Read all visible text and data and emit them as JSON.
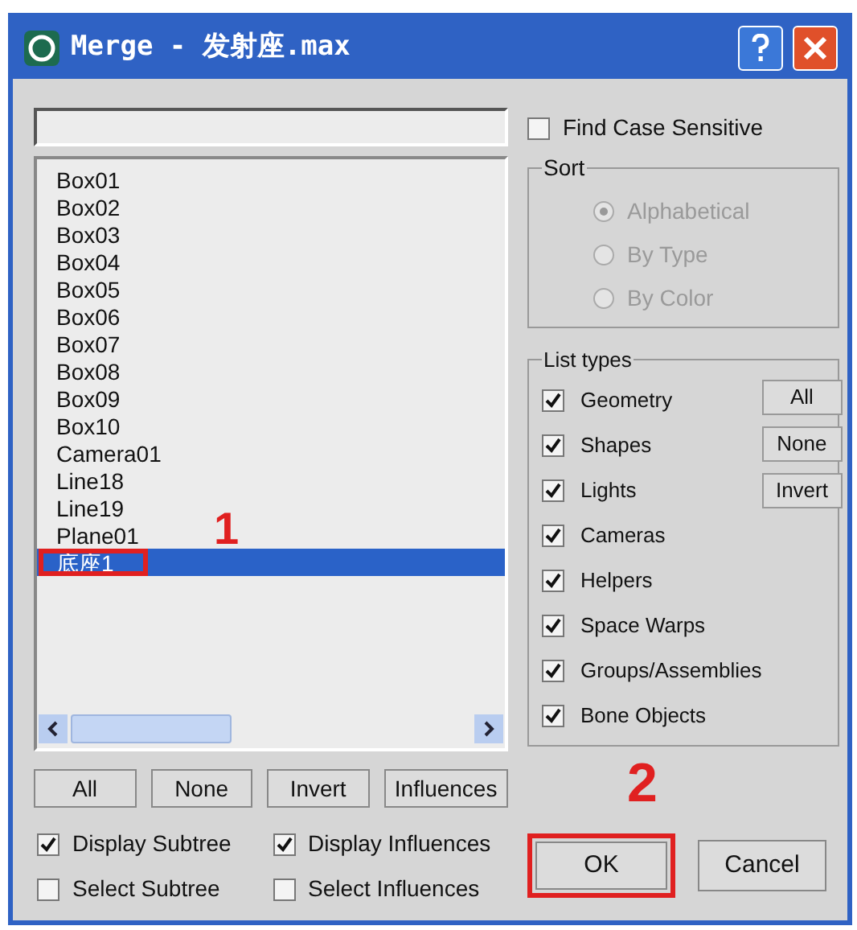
{
  "window": {
    "title": "Merge - 发射座.max"
  },
  "objects": [
    {
      "label": "Box01",
      "selected": false
    },
    {
      "label": "Box02",
      "selected": false
    },
    {
      "label": "Box03",
      "selected": false
    },
    {
      "label": "Box04",
      "selected": false
    },
    {
      "label": "Box05",
      "selected": false
    },
    {
      "label": "Box06",
      "selected": false
    },
    {
      "label": "Box07",
      "selected": false
    },
    {
      "label": "Box08",
      "selected": false
    },
    {
      "label": "Box09",
      "selected": false
    },
    {
      "label": "Box10",
      "selected": false
    },
    {
      "label": "Camera01",
      "selected": false
    },
    {
      "label": "Line18",
      "selected": false
    },
    {
      "label": "Line19",
      "selected": false
    },
    {
      "label": "Plane01",
      "selected": false
    },
    {
      "label": "底座1",
      "selected": true
    }
  ],
  "list_buttons": [
    "All",
    "None",
    "Invert",
    "Influences"
  ],
  "options": [
    {
      "label": "Display Subtree",
      "checked": true
    },
    {
      "label": "Display Influences",
      "checked": true
    },
    {
      "label": "Select Subtree",
      "checked": false
    },
    {
      "label": "Select Influences",
      "checked": false
    }
  ],
  "find_case_sensitive": {
    "label": "Find Case Sensitive",
    "checked": false
  },
  "sort": {
    "title": "Sort",
    "disabled": true,
    "options": [
      {
        "label": "Alphabetical",
        "selected": true
      },
      {
        "label": "By Type",
        "selected": false
      },
      {
        "label": "By Color",
        "selected": false
      }
    ]
  },
  "list_types": {
    "title": "List types",
    "items": [
      {
        "label": "Geometry",
        "checked": true
      },
      {
        "label": "Shapes",
        "checked": true
      },
      {
        "label": "Lights",
        "checked": true
      },
      {
        "label": "Cameras",
        "checked": true
      },
      {
        "label": "Helpers",
        "checked": true
      },
      {
        "label": "Space Warps",
        "checked": true
      },
      {
        "label": "Groups/Assemblies",
        "checked": true
      },
      {
        "label": "Bone Objects",
        "checked": true
      }
    ],
    "buttons": [
      "All",
      "None",
      "Invert"
    ]
  },
  "dialog_buttons": [
    "OK",
    "Cancel"
  ],
  "annotations": [
    "1",
    "2"
  ]
}
